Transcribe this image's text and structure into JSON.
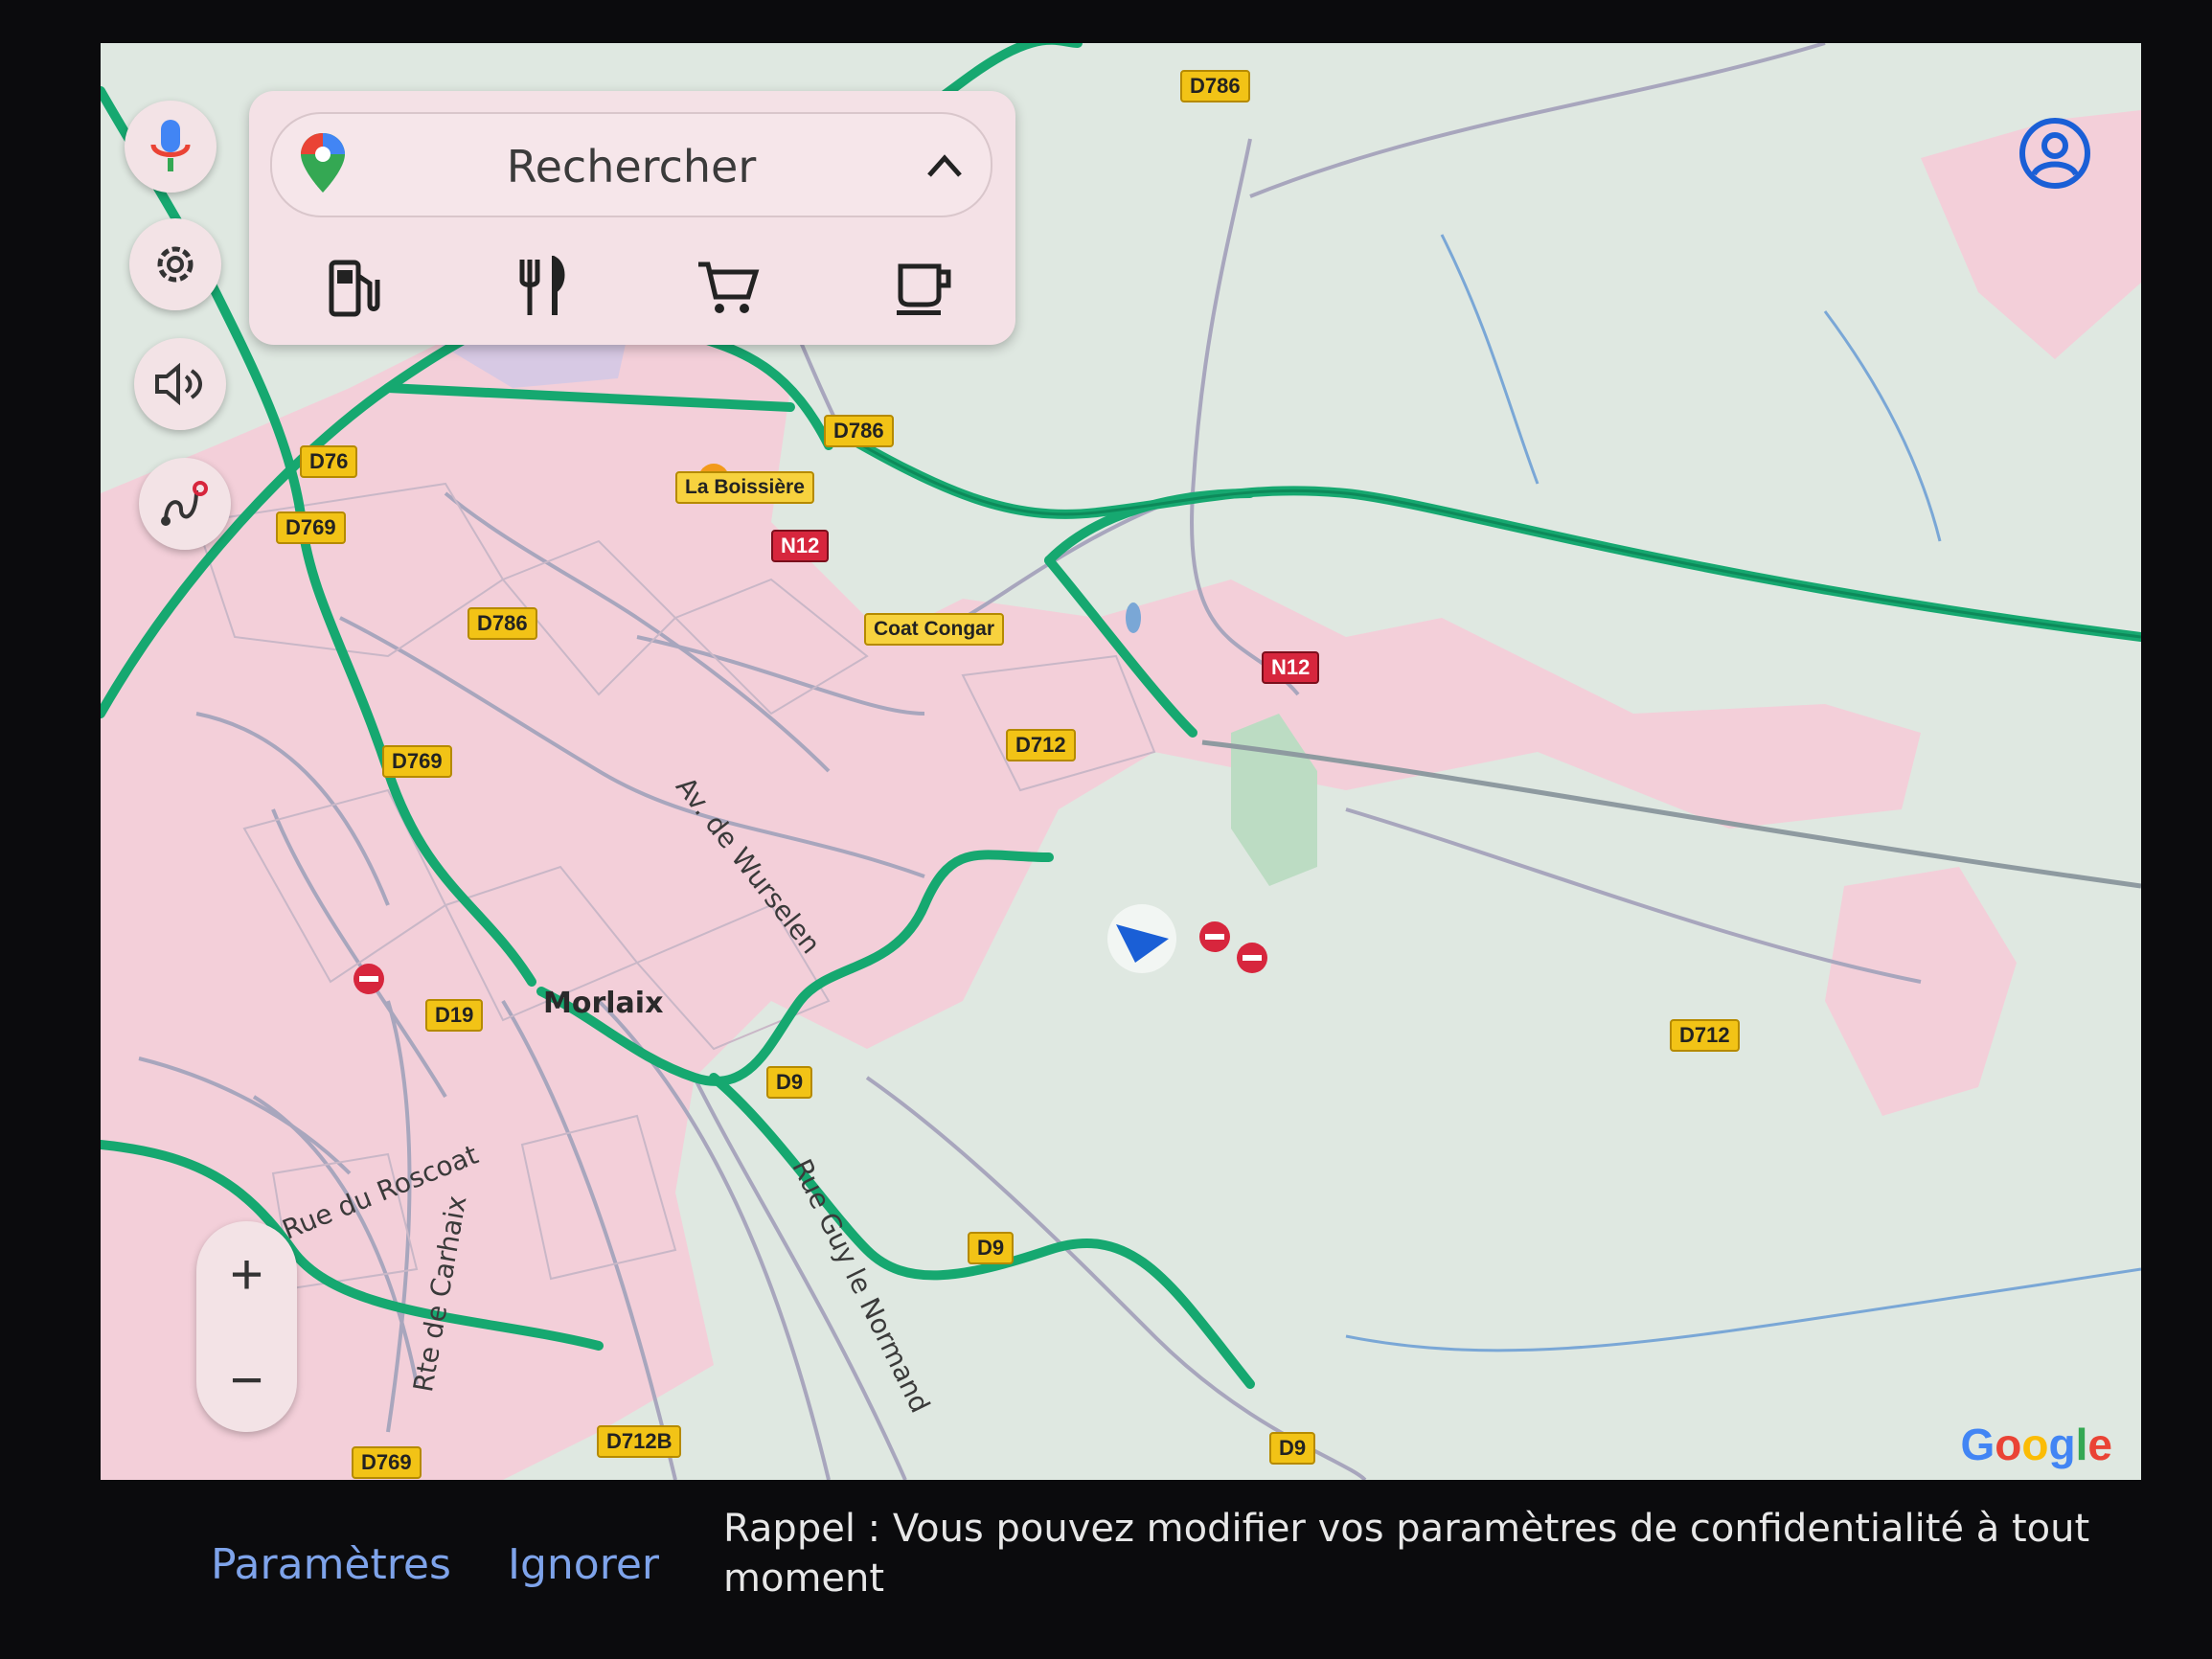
{
  "search": {
    "text": "Rechercher"
  },
  "buttons": {
    "microphone": "microphone-icon",
    "settings": "gear-icon",
    "volume": "speaker-icon",
    "route": "route-icon",
    "account": "account-icon",
    "zoom_in": "+",
    "zoom_out": "−"
  },
  "categories": [
    {
      "name": "fuel",
      "icon": "gas-station-icon"
    },
    {
      "name": "restaurants",
      "icon": "fork-knife-icon"
    },
    {
      "name": "shopping",
      "icon": "shopping-cart-icon"
    },
    {
      "name": "cafe",
      "icon": "coffee-cup-icon"
    }
  ],
  "map": {
    "road_labels": [
      {
        "text": "D786",
        "kind": "yellow"
      },
      {
        "text": "D786",
        "kind": "yellow"
      },
      {
        "text": "D76",
        "kind": "yellow"
      },
      {
        "text": "D769",
        "kind": "yellow"
      },
      {
        "text": "D786",
        "kind": "yellow"
      },
      {
        "text": "N12",
        "kind": "red"
      },
      {
        "text": "N12",
        "kind": "red"
      },
      {
        "text": "D712",
        "kind": "yellow"
      },
      {
        "text": "D769",
        "kind": "yellow"
      },
      {
        "text": "D19",
        "kind": "yellow"
      },
      {
        "text": "D9",
        "kind": "yellow"
      },
      {
        "text": "D9",
        "kind": "yellow"
      },
      {
        "text": "D712",
        "kind": "yellow"
      },
      {
        "text": "D712B",
        "kind": "yellow"
      },
      {
        "text": "D9",
        "kind": "yellow"
      },
      {
        "text": "D769",
        "kind": "yellow"
      }
    ],
    "place_labels": [
      "La Boissière",
      "Coat Congar"
    ],
    "town": "Morlaix",
    "streets": [
      "Av. de Wurselen",
      "Rue du Roscoat",
      "Rue Guy le Normand",
      "Rte de Carhaix"
    ],
    "attribution": [
      "G",
      "o",
      "o",
      "g",
      "l",
      "e"
    ],
    "attribution_colors": [
      "#4285F4",
      "#EA4335",
      "#FBBC05",
      "#4285F4",
      "#34A853",
      "#EA4335"
    ]
  },
  "bottom": {
    "settings_link": "Paramètres",
    "ignore_link": "Ignorer",
    "reminder": "Rappel : Vous pouvez modifier vos paramètres de confidentialité à tout moment"
  },
  "colors": {
    "map_bg": "#dfe8e1",
    "urban": "#f3cfd9",
    "highway": "#16a870",
    "minor_road": "#a8a6bd",
    "accent_blue": "#1a5fd6"
  }
}
